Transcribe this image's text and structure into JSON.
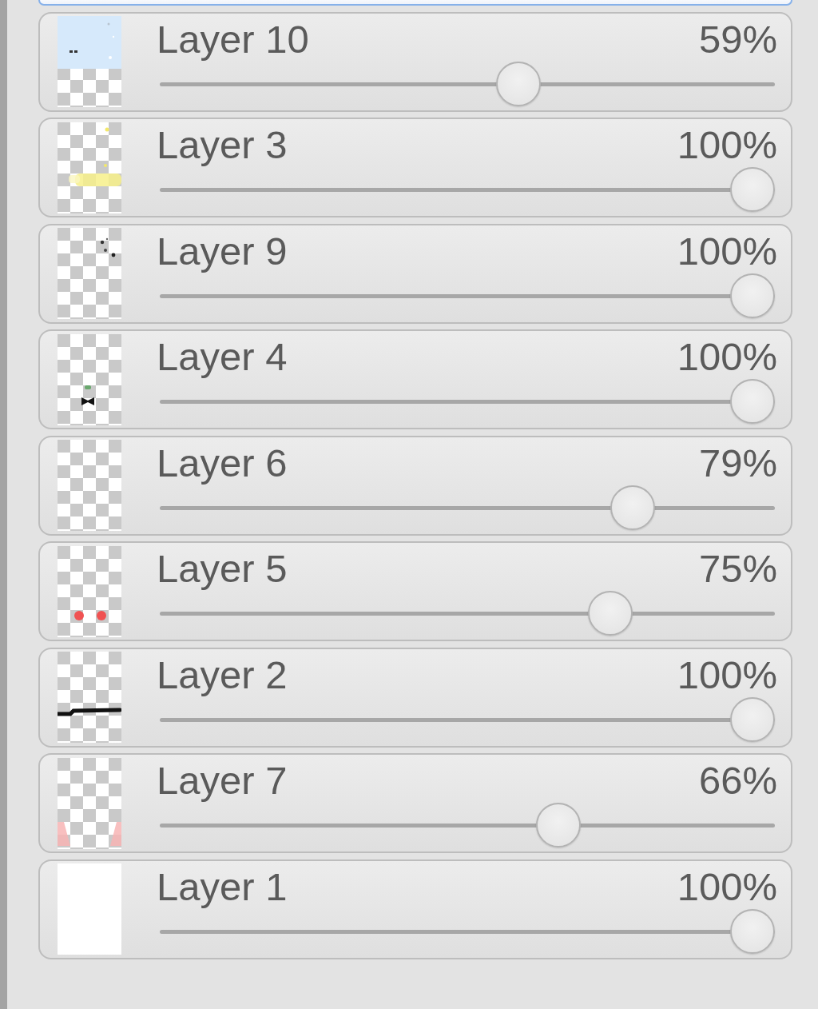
{
  "layers": [
    {
      "selected": true
    },
    {
      "name": "Layer 10",
      "opacity": "59%",
      "level": 0.59,
      "thumbnail": {
        "kind": "sky"
      },
      "selected": false
    },
    {
      "name": "Layer 3",
      "opacity": "100%",
      "level": 1,
      "thumbnail": {
        "kind": "glow"
      },
      "selected": false
    },
    {
      "name": "Layer 9",
      "opacity": "100%",
      "level": 1,
      "thumbnail": {
        "kind": "specks"
      },
      "selected": false
    },
    {
      "name": "Layer 4",
      "opacity": "100%",
      "level": 1,
      "thumbnail": {
        "kind": "bowtie"
      },
      "selected": false
    },
    {
      "name": "Layer 6",
      "opacity": "79%",
      "level": 0.79,
      "thumbnail": {
        "kind": "blank"
      },
      "selected": false
    },
    {
      "name": "Layer 5",
      "opacity": "75%",
      "level": 0.75,
      "thumbnail": {
        "kind": "dots"
      },
      "selected": false
    },
    {
      "name": "Layer 2",
      "opacity": "100%",
      "level": 1,
      "thumbnail": {
        "kind": "stroke"
      },
      "selected": false
    },
    {
      "name": "Layer 7",
      "opacity": "66%",
      "level": 0.66,
      "thumbnail": {
        "kind": "blush"
      },
      "selected": false
    },
    {
      "name": "Layer 1",
      "opacity": "100%",
      "level": 1,
      "thumbnail": {
        "kind": "white"
      },
      "selected": false
    }
  ]
}
